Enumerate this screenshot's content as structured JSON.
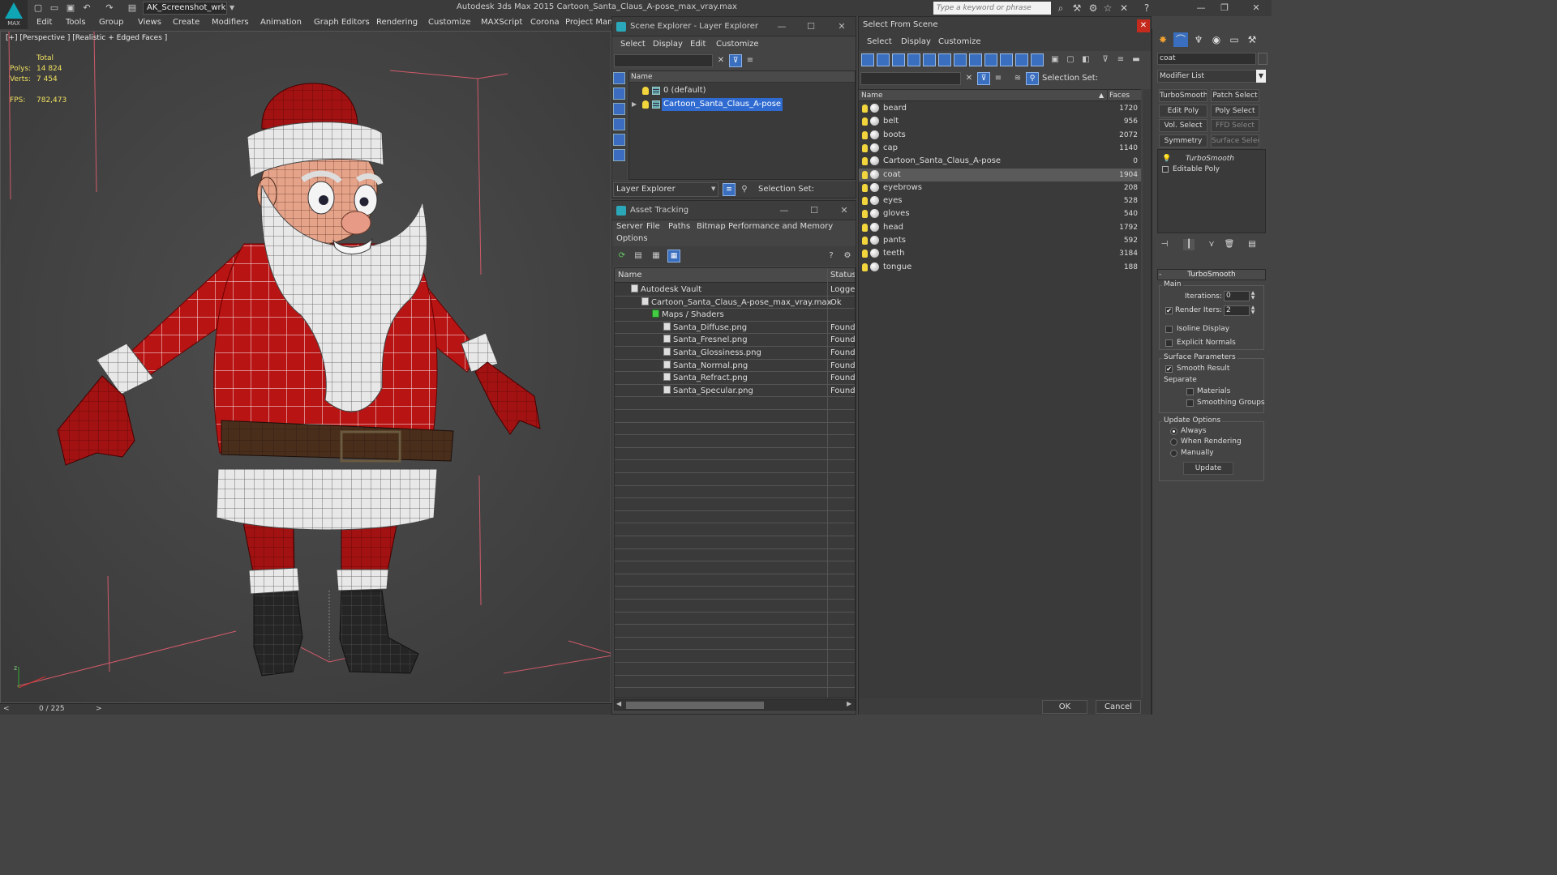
{
  "app": {
    "logo_label": "MAX",
    "workspace": "AK_Screenshot_wrksp",
    "title": "Autodesk 3ds Max  2015      Cartoon_Santa_Claus_A-pose_max_vray.max",
    "search_placeholder": "Type a keyword or phrase"
  },
  "menu": [
    "Edit",
    "Tools",
    "Group",
    "Views",
    "Create",
    "Modifiers",
    "Animation",
    "Graph Editors",
    "Rendering",
    "Customize",
    "MAXScript",
    "Corona",
    "Project Man"
  ],
  "viewport": {
    "label": "[+] [Perspective ] [Realistic + Edged Faces ]",
    "stats": {
      "total_label": "Total",
      "polys_label": "Polys:",
      "polys": "14 824",
      "verts_label": "Verts:",
      "verts": "7 454",
      "fps_label": "FPS:",
      "fps": "782,473"
    },
    "time_slider": "0 / 225"
  },
  "scene_explorer": {
    "title": "Scene Explorer - Layer Explorer",
    "menu": [
      "Select",
      "Display",
      "Edit",
      "Customize"
    ],
    "column_name": "Name",
    "layers": [
      {
        "name": "0 (default)",
        "selected": false
      },
      {
        "name": "Cartoon_Santa_Claus_A-pose",
        "selected": true
      }
    ],
    "explorer_dropdown": "Layer Explorer",
    "selection_set_label": "Selection Set:"
  },
  "asset_tracking": {
    "title": "Asset Tracking",
    "menu": [
      "Server",
      "File",
      "Paths",
      "Bitmap Performance and Memory",
      "Options"
    ],
    "columns": [
      "Name",
      "Status"
    ],
    "rows": [
      {
        "name": "Autodesk Vault",
        "status": "Logged",
        "indent": 0
      },
      {
        "name": "Cartoon_Santa_Claus_A-pose_max_vray.max",
        "status": "Ok",
        "indent": 1
      },
      {
        "name": "Maps / Shaders",
        "status": "",
        "indent": 2
      },
      {
        "name": "Santa_Diffuse.png",
        "status": "Found",
        "indent": 3
      },
      {
        "name": "Santa_Fresnel.png",
        "status": "Found",
        "indent": 3
      },
      {
        "name": "Santa_Glossiness.png",
        "status": "Found",
        "indent": 3
      },
      {
        "name": "Santa_Normal.png",
        "status": "Found",
        "indent": 3
      },
      {
        "name": "Santa_Refract.png",
        "status": "Found",
        "indent": 3
      },
      {
        "name": "Santa_Specular.png",
        "status": "Found",
        "indent": 3
      }
    ]
  },
  "select_from_scene": {
    "title": "Select From Scene",
    "menu": [
      "Select",
      "Display",
      "Customize"
    ],
    "selection_set_label": "Selection Set:",
    "columns": [
      "Name",
      "Faces"
    ],
    "objects": [
      {
        "name": "beard",
        "faces": "1720",
        "selected": false
      },
      {
        "name": "belt",
        "faces": "956",
        "selected": false
      },
      {
        "name": "boots",
        "faces": "2072",
        "selected": false
      },
      {
        "name": "cap",
        "faces": "1140",
        "selected": false
      },
      {
        "name": "Cartoon_Santa_Claus_A-pose",
        "faces": "0",
        "selected": false
      },
      {
        "name": "coat",
        "faces": "1904",
        "selected": true
      },
      {
        "name": "eyebrows",
        "faces": "208",
        "selected": false
      },
      {
        "name": "eyes",
        "faces": "528",
        "selected": false
      },
      {
        "name": "gloves",
        "faces": "540",
        "selected": false
      },
      {
        "name": "head",
        "faces": "1792",
        "selected": false
      },
      {
        "name": "pants",
        "faces": "592",
        "selected": false
      },
      {
        "name": "teeth",
        "faces": "3184",
        "selected": false
      },
      {
        "name": "tongue",
        "faces": "188",
        "selected": false
      }
    ],
    "ok_label": "OK",
    "cancel_label": "Cancel"
  },
  "command_panel": {
    "object_name": "coat",
    "modifier_list": "Modifier List",
    "modifier_buttons": [
      {
        "label": "TurboSmooth",
        "dim": false
      },
      {
        "label": "Patch Select",
        "dim": false
      },
      {
        "label": "Edit Poly",
        "dim": false
      },
      {
        "label": "Poly Select",
        "dim": false
      },
      {
        "label": "Vol. Select",
        "dim": false
      },
      {
        "label": "FFD Select",
        "dim": true
      },
      {
        "label": "Symmetry",
        "dim": false
      },
      {
        "label": "Surface Select",
        "dim": true
      }
    ],
    "stack": [
      "TurboSmooth",
      "Editable Poly"
    ],
    "rollout_title": "TurboSmooth",
    "main_label": "Main",
    "iterations_label": "Iterations:",
    "iterations": "0",
    "render_iters_label": "Render Iters:",
    "render_iters": "2",
    "render_iters_checked": true,
    "isoline_label": "Isoline Display",
    "explicit_normals_label": "Explicit Normals",
    "surface_params_label": "Surface Parameters",
    "smooth_result_label": "Smooth Result",
    "separate_label": "Separate",
    "materials_label": "Materials",
    "smoothing_groups_label": "Smoothing Groups",
    "update_options_label": "Update Options",
    "always_label": "Always",
    "when_rendering_label": "When Rendering",
    "manually_label": "Manually",
    "update_button": "Update"
  },
  "colors": {
    "accent_blue": "#2f6bd1",
    "close_red": "#c42b1c",
    "stats_yellow": "#f0e060",
    "santa_red": "#b81414"
  }
}
